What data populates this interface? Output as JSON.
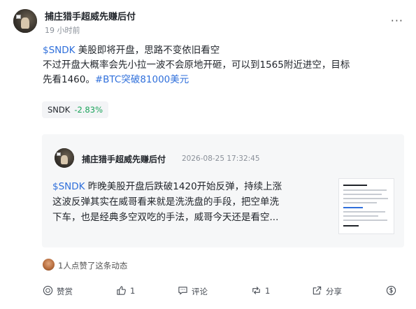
{
  "post": {
    "author": "捕庄猎手超威先赚后付",
    "time": "19 小时前",
    "more": "···",
    "lines": [
      {
        "tag": "$SNDK",
        "text": " 美股即将开盘，思路不变依旧看空"
      },
      {
        "text": "不过开盘大概率会先小拉一波不会原地开砸，可以到1565附近进空，目标"
      },
      {
        "text": "先看1460。",
        "tag": "#BTC突破81000美元"
      }
    ],
    "ticker": {
      "symbol": "SNDK",
      "change": "-2.83%",
      "change_color": "#1aa35a"
    },
    "tag_color": "#2f6fdb"
  },
  "quote": {
    "author": "捕庄猎手超威先赚后付",
    "time": "2026-08-25 17:32:45",
    "lines": [
      {
        "tag": "$SNDK",
        "text": " 昨晚美股开盘后跌破1420开始反弹，持续上涨"
      },
      {
        "text": "这波反弹其实在威哥看来就是洗洗盘的手段，把空单洗"
      },
      {
        "text": "下车，也是经典多空双吃的手法，威哥今天还是看空..."
      }
    ]
  },
  "likes": {
    "text": "1人点赞了这条动态"
  },
  "actions": {
    "reward": "赞赏",
    "like": "1",
    "comment": "评论",
    "repost": "1",
    "share": "分享"
  },
  "icons": [
    "reward-icon",
    "like-icon",
    "comment-icon",
    "repost-icon",
    "share-icon",
    "cash-icon",
    "more-icon"
  ]
}
